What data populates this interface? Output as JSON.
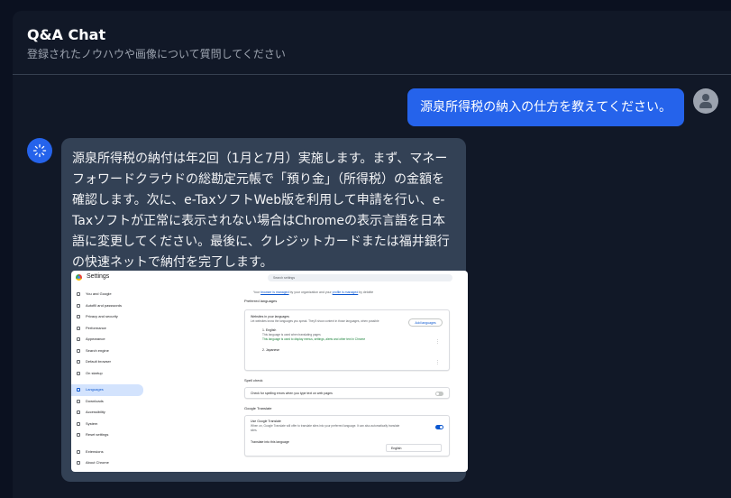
{
  "header": {
    "title": "Q&A Chat",
    "subtitle": "登録されたノウハウや画像について質問してください"
  },
  "messages": {
    "user": {
      "text": "源泉所得税の納入の仕方を教えてください。"
    },
    "bot": {
      "text": "源泉所得税の納付は年2回（1月と7月）実施します。まず、マネーフォワードクラウドの総勘定元帳で「預り金」（所得税）の金額を確認します。次に、e-TaxソフトWeb版を利用して申請を行い、e-Taxソフトが正常に表示されない場合はChromeの表示言語を日本語に変更してください。最後に、クレジットカードまたは福井銀行の快速ネットで納付を完了します。"
    }
  },
  "screenshot": {
    "title": "Settings",
    "search_placeholder": "Search settings",
    "nav": [
      {
        "label": "You and Google",
        "icon": "google-icon",
        "active": false
      },
      {
        "label": "Autofill and passwords",
        "icon": "autofill-icon",
        "active": false
      },
      {
        "label": "Privacy and security",
        "icon": "shield-icon",
        "active": false
      },
      {
        "label": "Performance",
        "icon": "speedometer-icon",
        "active": false
      },
      {
        "label": "Appearance",
        "icon": "palette-icon",
        "active": false
      },
      {
        "label": "Search engine",
        "icon": "search-icon",
        "active": false
      },
      {
        "label": "Default browser",
        "icon": "browser-icon",
        "active": false
      },
      {
        "label": "On startup",
        "icon": "power-icon",
        "active": false
      },
      {
        "label": "Languages",
        "icon": "translate-icon",
        "active": true
      },
      {
        "label": "Downloads",
        "icon": "download-icon",
        "active": false
      },
      {
        "label": "Accessibility",
        "icon": "accessibility-icon",
        "active": false
      },
      {
        "label": "System",
        "icon": "wrench-icon",
        "active": false
      },
      {
        "label": "Reset settings",
        "icon": "reset-icon",
        "active": false
      },
      {
        "label": "Extensions",
        "icon": "puzzle-icon",
        "active": false
      },
      {
        "label": "About Chrome",
        "icon": "chrome-icon",
        "active": false
      }
    ],
    "managed_note": {
      "pre": "Your",
      "browser_link": "browser is managed",
      "mid": "by your organization and your",
      "profile_link": "profile is managed",
      "post": "by deloitte"
    },
    "preferred_languages": {
      "heading": "Preferred languages",
      "card_title": "Websites in your languages",
      "card_desc": "Let websites know the languages you speak. They'll show content in those languages, when possible",
      "add_button": "Add languages",
      "lang1_name": "1. English",
      "lang1_sub1": "This language is used when translating pages",
      "lang1_sub2": "This language is used to display menus, settings, alerts and other text in Chrome",
      "lang2_name": "2. Japanese"
    },
    "spell_check": {
      "heading": "Spell check",
      "label": "Check for spelling errors when you type text on web pages"
    },
    "google_translate": {
      "heading": "Google Translate",
      "use_title": "Use Google Translate",
      "use_desc": "When on, Google Translate will offer to translate sites into your preferred language. It can also automatically translate sites.",
      "translate_into_label": "Translate into this language",
      "translate_into_value": "English"
    }
  }
}
